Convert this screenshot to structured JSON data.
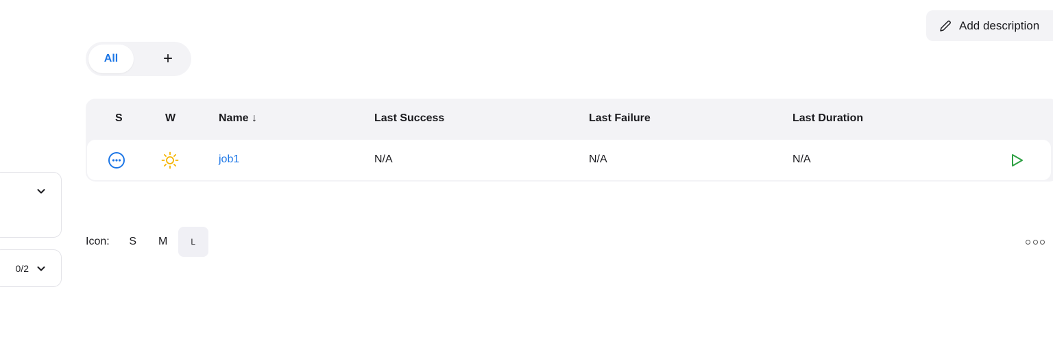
{
  "header": {
    "add_description_label": "Add description"
  },
  "views": {
    "tabs": [
      {
        "label": "All",
        "active": true
      }
    ],
    "add_label": "+"
  },
  "table": {
    "columns": [
      "S",
      "W",
      "Name ↓",
      "Last Success",
      "Last Failure",
      "Last Duration"
    ],
    "rows": [
      {
        "status_icon": "in-progress-icon",
        "weather_icon": "sunny-icon",
        "name": "job1",
        "last_success": "N/A",
        "last_failure": "N/A",
        "last_duration": "N/A",
        "action_icon": "build-now-play-icon"
      }
    ]
  },
  "icon_size": {
    "label": "Icon:",
    "options": [
      "S",
      "M",
      "L"
    ],
    "selected": "L"
  },
  "sidebar": {
    "executors_count": "0/2"
  },
  "colors": {
    "accent": "#1c76e6",
    "weather": "#f5b400",
    "success": "#2ea043",
    "panel": "#f3f3f6"
  }
}
